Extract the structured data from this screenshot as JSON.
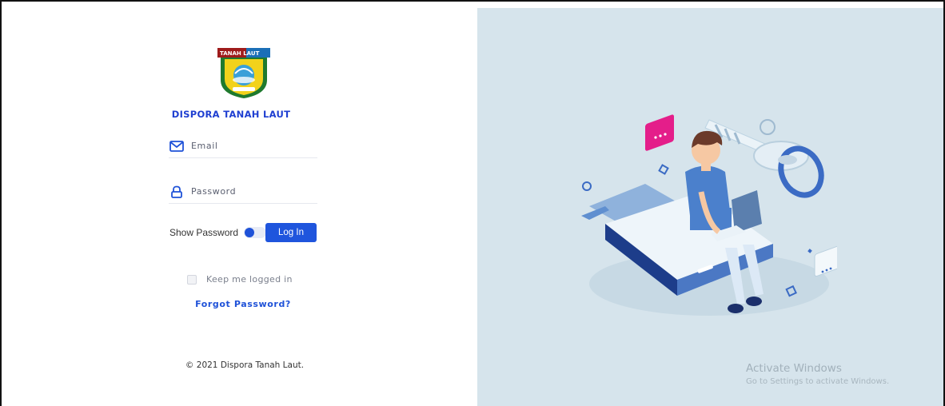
{
  "brand": {
    "name": "DISPORA TANAH LAUT",
    "logo_text": "TANAH LAUT"
  },
  "form": {
    "email_placeholder": "Email",
    "password_placeholder": "Password",
    "show_password_label": "Show Password",
    "show_password_on": true,
    "login_button": "Log In",
    "keep_logged_label": "Keep me logged in",
    "keep_logged_checked": false,
    "forgot_password": "Forgot Password?"
  },
  "footer": {
    "copyright": "© 2021 Dispora Tanah Laut."
  },
  "watermark": {
    "title": "Activate Windows",
    "subtitle": "Go to Settings to activate Windows."
  },
  "colors": {
    "accent": "#1f55dd",
    "right_panel_bg": "#d6e4ec"
  }
}
